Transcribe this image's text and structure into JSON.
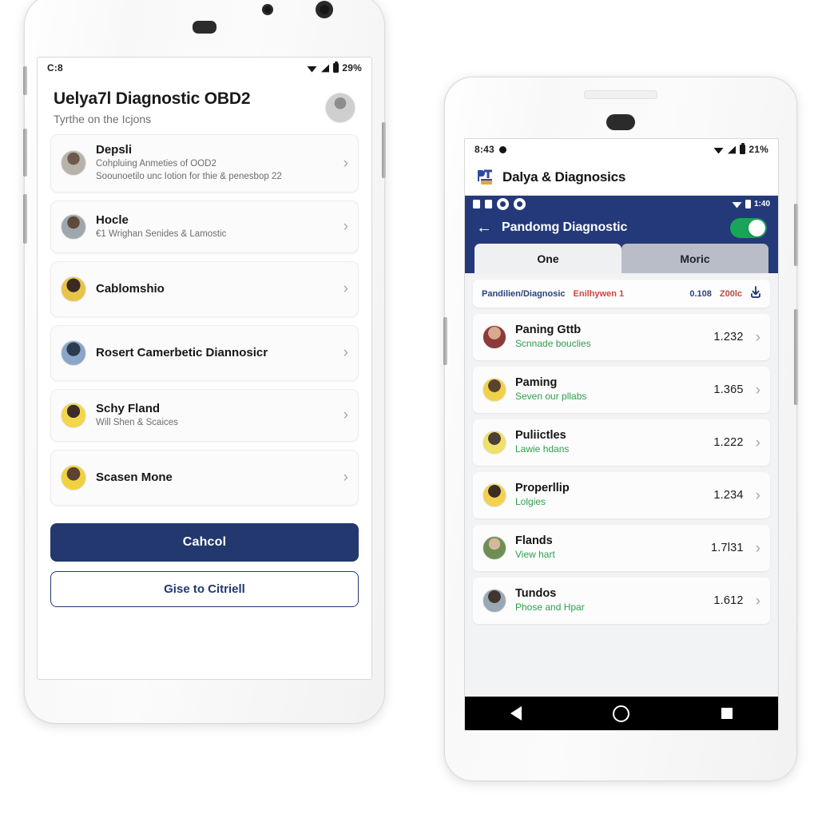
{
  "left_phone": {
    "status_bar": {
      "time": "C:8",
      "battery_pct": "29%"
    },
    "header": {
      "title": "Uelya7l Diagnostic OBD2",
      "subtitle": "Tyrthe on the Icjons"
    },
    "items": [
      {
        "name": "Depsli",
        "desc_line1": "Cohpluing Anmeties of OOD2",
        "desc_line2": "Soounoetilo unc Iotion for thie & penesbop 22",
        "chevron": "›",
        "avatar_hex": "#8c8c8c"
      },
      {
        "name": "Hocle",
        "desc_line1": "€1 Wrighan Senides & Lamostic",
        "desc_line2": "",
        "chevron": "›",
        "avatar_hex": "#7a7f86"
      },
      {
        "name": "Cablomshio",
        "desc_line1": "",
        "desc_line2": "",
        "chevron": "›",
        "avatar_hex": "#e8c34a"
      },
      {
        "name": "Rosert Camerbetic Diannosicr",
        "desc_line1": "",
        "desc_line2": "",
        "chevron": "›",
        "avatar_hex": "#7f93b5"
      },
      {
        "name": "Schy Fland",
        "desc_line1": "Will Shen & Scaices",
        "desc_line2": "",
        "chevron": "›",
        "avatar_hex": "#f2d64b"
      },
      {
        "name": "Scasen Mone",
        "desc_line1": "",
        "desc_line2": "",
        "chevron": "›",
        "avatar_hex": "#f0d23f"
      }
    ],
    "buttons": {
      "primary": "Cahcol",
      "secondary": "Gise to Citriell"
    },
    "colors": {
      "primary_navy": "#22386e"
    }
  },
  "right_phone": {
    "status_bar": {
      "time": "8:43",
      "battery_pct": "21%"
    },
    "app_bar": {
      "title": "Dalya & Diagnosics",
      "logo": "pit-logo-icon"
    },
    "navy_status": {
      "time": "1:40"
    },
    "toolbar": {
      "back": "←",
      "title": "Pandomg Diagnostic",
      "toggle_on": true
    },
    "tabs": [
      {
        "label": "One",
        "active": true
      },
      {
        "label": "Moric",
        "active": false
      }
    ],
    "info_bar": {
      "label": "Pandilien/Diagnosic",
      "badge": "Enilhywen 1",
      "value": "0.108",
      "value2": "Z00lc",
      "download_icon": "download-icon"
    },
    "rows": [
      {
        "name": "Paning Gttb",
        "sub": "Scnnade bouclies",
        "value": "1.232",
        "chevron": "›",
        "avatar_hex": "#8d3a3a"
      },
      {
        "name": "Paming",
        "sub": "Seven our pllabs",
        "value": "1.365",
        "chevron": "›",
        "avatar_hex": "#efd24a"
      },
      {
        "name": "Puliictles",
        "sub": "Lawie hdans",
        "value": "1.222",
        "chevron": "›",
        "avatar_hex": "#f0e06a"
      },
      {
        "name": "Properllip",
        "sub": "Lolgies",
        "value": "1.234",
        "chevron": "›",
        "avatar_hex": "#f2d152"
      },
      {
        "name": "Flands",
        "sub": "View hart",
        "value": "1.7l31",
        "chevron": "›",
        "avatar_hex": "#6e8f54"
      },
      {
        "name": "Tundos",
        "sub": "Phose and Hpar",
        "value": "1.612",
        "chevron": "›",
        "avatar_hex": "#9aa7b4"
      }
    ],
    "nav_bar": {
      "back": "nav-back-icon",
      "home": "nav-home-icon",
      "recents": "nav-recents-icon"
    },
    "colors": {
      "navy": "#24397a",
      "toggle_green": "#18a558",
      "sub_green": "#2f9e4f"
    }
  }
}
